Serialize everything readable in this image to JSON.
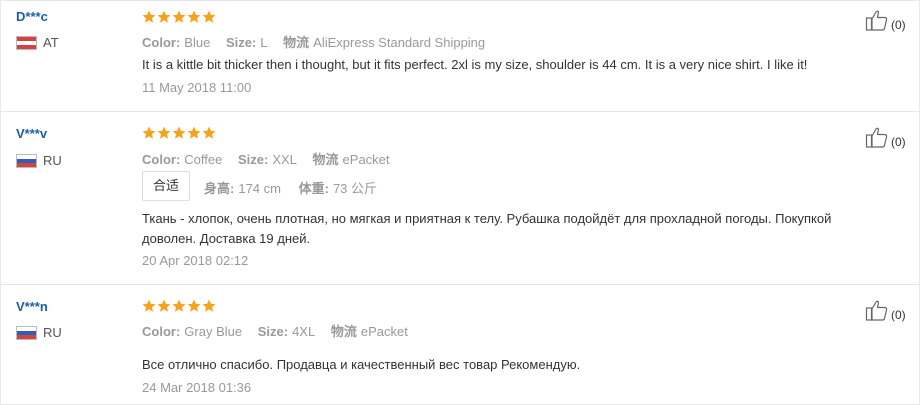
{
  "reviews": [
    {
      "user": "D***c",
      "country": "AT",
      "flag": "flag-at",
      "rating": 5,
      "color_label": "Color:",
      "color_value": "Blue",
      "size_label": "Size:",
      "size_value": "L",
      "shipping_label": "物流",
      "shipping_value": "AliExpress Standard Shipping",
      "text": "It is a kittle bit thicker then i thought, but it fits perfect. 2xl is my size, shoulder is 44 cm. It is a very nice shirt. I like it!",
      "date": "11 May 2018 11:00",
      "likes": "(0)"
    },
    {
      "user": "V***v",
      "country": "RU",
      "flag": "flag-ru",
      "rating": 5,
      "color_label": "Color:",
      "color_value": "Coffee",
      "size_label": "Size:",
      "size_value": "XXL",
      "shipping_label": "物流",
      "shipping_value": "ePacket",
      "fit_tag": "合适",
      "height_label": "身高:",
      "height_value": "174 cm",
      "weight_label": "体重:",
      "weight_value": "73 公斤",
      "text_line1": "Ткань - хлопок, очень плотная, но мягкая и приятная к телу. Рубашка подойдёт для прохладной погоды. Покупкой",
      "text_line2": "доволен. Доставка 19 дней.",
      "date": "20 Apr 2018 02:12",
      "likes": "(0)"
    },
    {
      "user": "V***n",
      "country": "RU",
      "flag": "flag-ru",
      "rating": 5,
      "color_label": "Color:",
      "color_value": "Gray Blue",
      "size_label": "Size:",
      "size_value": "4XL",
      "shipping_label": "物流",
      "shipping_value": "ePacket",
      "text": "Все отлично спасибо. Продавца и качественный вес товар Рекомендую.",
      "date": "24 Mar 2018 01:36",
      "likes": "(0)"
    }
  ],
  "colors": {
    "star": "#f7a21b",
    "username": "#1a5fa8",
    "muted": "#999999",
    "separator": "#e6e6e6"
  }
}
